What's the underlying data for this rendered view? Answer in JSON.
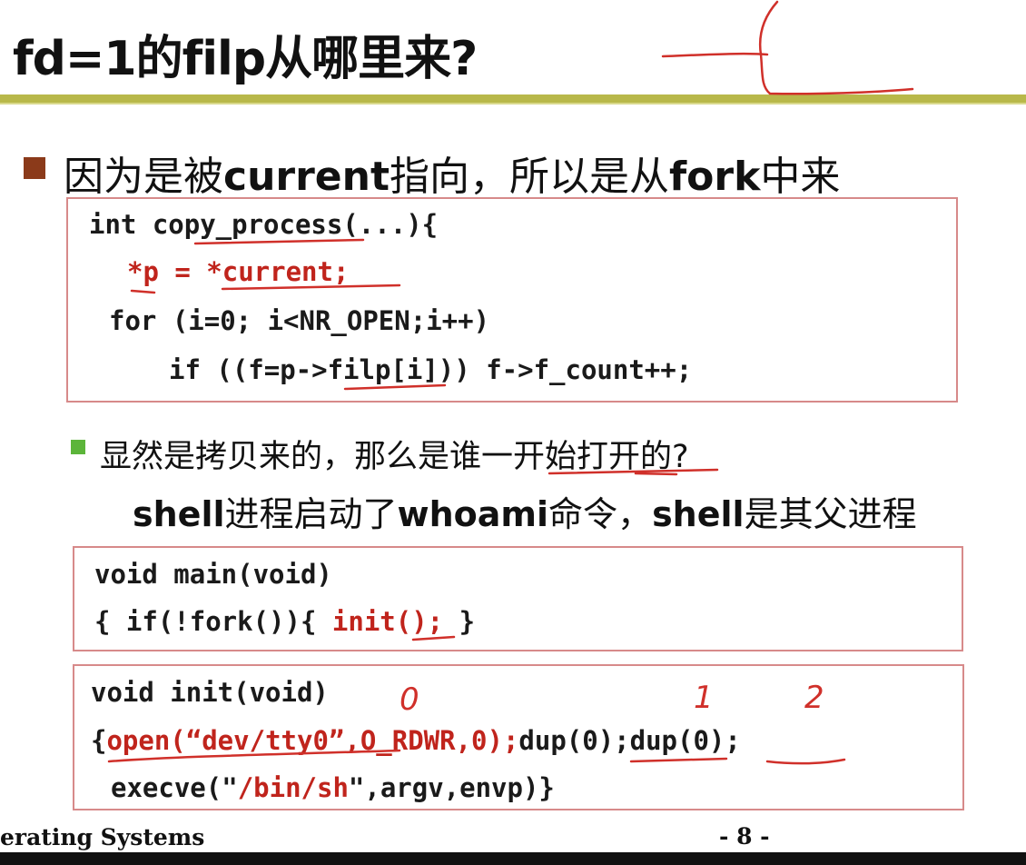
{
  "title": "fd=1的filp从哪里来?",
  "bullet1": {
    "pre": "因为是被",
    "bold1": "current",
    "mid": "指向，所以是从",
    "bold2": "fork",
    "post": "中来"
  },
  "code1": {
    "line1": "int copy_process(...){",
    "line2": "*p = *current;",
    "line3": "for (i=0; i<NR_OPEN;i++)",
    "line4": "if ((f=p->filp[i])) f->f_count++;"
  },
  "bullet2": "显然是拷贝来的，那么是谁一开始打开的?",
  "bullet3": {
    "bold1": "shell",
    "mid1": "进程启动了",
    "bold2": "whoami",
    "mid2": "命令，",
    "bold3": "shell",
    "post": "是其父进程"
  },
  "code2": {
    "line1": "void main(void)",
    "line2_pre": "{ if(!fork()){ ",
    "line2_red": "init();",
    "line2_post": " }"
  },
  "code3": {
    "line1": "void init(void)",
    "line2_pre": "{",
    "line2_red": "open(“dev/tty0”,O_RDWR,0);",
    "line2_post": "dup(0);dup(0);",
    "line3_pre": "execve(\"",
    "line3_red": "/bin/sh",
    "line3_post": "\",argv,envp)}"
  },
  "annotations": [
    "0",
    "1",
    "2"
  ],
  "footer": {
    "left": "erating Systems",
    "page": "- 8 -"
  },
  "colors": {
    "accent_rule": "#b8b84a",
    "bullet1": "#8b3a1a",
    "bullet2": "#5cb53a",
    "code_red": "#c0241c",
    "box_border": "#d78a8a",
    "ink": "#d0302a"
  }
}
